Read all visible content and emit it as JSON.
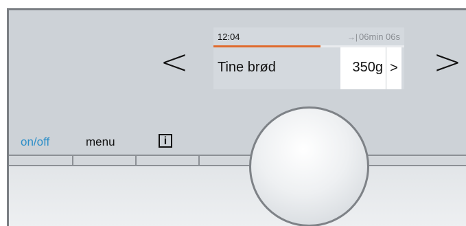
{
  "display": {
    "clock": "12:04",
    "timer_icon": "→|",
    "timer_remaining": "06min 06s",
    "progress_fraction": 0.56,
    "program_name": "Tine brød",
    "weight": "350g",
    "weight_next": ">"
  },
  "navigation": {
    "prev_label": "<",
    "next_label": ">"
  },
  "buttons": {
    "onoff_label": "on/off",
    "menu_label": "menu",
    "info_label": "i"
  },
  "colors": {
    "accent_blue": "#2e8fc8",
    "progress_orange": "#e06a2c",
    "panel_gray": "#cdd2d7"
  },
  "icons": {
    "timer": "end-time-icon",
    "info": "info-icon",
    "knob": "rotary-knob"
  }
}
